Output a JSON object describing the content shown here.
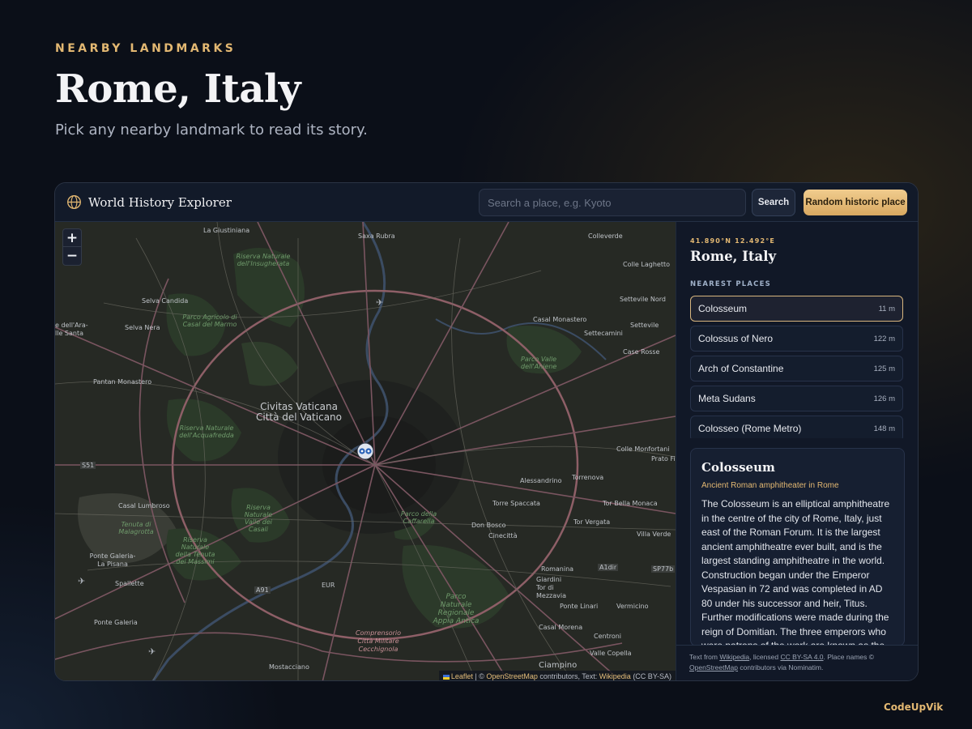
{
  "hero": {
    "eyebrow": "NEARBY LANDMARKS",
    "title": "Rome, Italy",
    "subtitle": "Pick any nearby landmark to read its story."
  },
  "app": {
    "title": "World History Explorer",
    "brand_icon": "globe-icon",
    "search_placeholder": "Search a place, e.g. Kyoto",
    "search_value": "",
    "search_label": "Search",
    "random_label": "Random historic place"
  },
  "map": {
    "zoom_in": "+",
    "zoom_out": "−",
    "marker_icon": "owl-marker-icon",
    "labels": {
      "la_giustiniana": "La Giustiniana",
      "saxa_rubra": "Saxa Rubra",
      "colleverde": "Colleverde",
      "colle_laghetto": "Colle Laghetto",
      "riserva_insugherata": "Riserva Naturale dell'Insugherata",
      "selva_candida": "Selva Candida",
      "parco_marmo": "Parco Agricolo di Casal del Marmo",
      "settevile_nord": "Settevile Nord",
      "casal_monastero": "Casal Monastero",
      "settecamini": "Settecamini",
      "settevile": "Settevile",
      "arat_santa": "e dell'Ara- lle Santa",
      "selva_nera": "Selva Nera",
      "case_rosse": "Case Rosse",
      "valle_aniene": "Parco Valle dell'Aniene",
      "pantan_monastero": "Pantan Monastero",
      "civitas_vaticana": "Civitas Vaticana Città del Vaticano",
      "riserva_acquafredda": "Riserva Naturale dell'Acquafredda",
      "colle_monfortani": "Colle Monfortani",
      "prato_fio": "Prato Fio",
      "s51": "S51",
      "alessandrino": "Alessandrino",
      "torrenova": "Torrenova",
      "casal_lumbroso": "Casal Lumbroso",
      "riserva_valle_galeria": "Riserva Naturale Valle dei Casali",
      "torre_spaccata": "Torre Spaccata",
      "tor_bella_monaca": "Tor Bella Monaca",
      "parco_caffarella": "Parco della Caffarella",
      "tenuta_malagrotta": "Tenuta di Malagrotta",
      "don_bosco": "Don Bosco",
      "tor_vergata": "Tor Vergata",
      "cinecitta": "Cinecittà",
      "villa_verde": "Villa Verde",
      "ponte_galeria_la_pisana": "Ponte Galeria-La Pisana",
      "riserva_tenuta": "Riserva Naturale della Tenuta dei Massimi",
      "a1dir": "A1dir",
      "sp77b": "SP77b",
      "spallette": "Spallette",
      "eur": "EUR",
      "a91": "A91",
      "romanina": "Romanina",
      "giardini_tor": "Giardini Tor di Mezzavia",
      "appia_antica": "Parco Naturale Regionale Appia Antica",
      "ponte_linari": "Ponte Linari",
      "vermicino": "Vermicino",
      "ponte_galeria": "Ponte Galeria",
      "casal_morena": "Casal Morena",
      "centroni": "Centroni",
      "cecchignola": "Comprensorio Città Militare Cecchignola",
      "valle_copella": "Valle Copella",
      "mostacciano": "Mostacciano",
      "ciampino": "Ciampino"
    },
    "attribution": {
      "leaflet": "Leaflet",
      "sep1": " | © ",
      "osm": "OpenStreetMap",
      "mid": " contributors, Text: ",
      "wiki": "Wikipedia",
      "end": " (CC BY-SA)"
    }
  },
  "sidebar": {
    "coords": "41.890°N 12.492°E",
    "place_title": "Rome, Italy",
    "nearest_heading": "NEAREST PLACES",
    "places": [
      {
        "name": "Colosseum",
        "distance": "11 m"
      },
      {
        "name": "Colossus of Nero",
        "distance": "122 m"
      },
      {
        "name": "Arch of Constantine",
        "distance": "125 m"
      },
      {
        "name": "Meta Sudans",
        "distance": "126 m"
      },
      {
        "name": "Colosseo (Rome Metro)",
        "distance": "148 m"
      }
    ],
    "article": {
      "title": "Colosseum",
      "subtitle": "Ancient Roman amphitheater in Rome",
      "body": "The Colosseum is an elliptical amphitheatre in the centre of the city of Rome, Italy, just east of the Roman Forum. It is the largest ancient amphitheatre ever built, and is the largest standing amphitheatre in the world. Construction began under the Emperor Vespasian in 72 and was completed in AD 80 under his successor and heir, Titus. Further modifications were made during the reign of Domitian. The three emperors who were patrons of the work are known as the Flavian dynasty, and the amphitheatre was named"
    },
    "footer": {
      "text_from": "Text from ",
      "wikipedia": "Wikipedia",
      "licensed": ", licensed ",
      "license": "CC BY-SA 4.0",
      "place_names": ". Place names © ",
      "osm": "OpenStreetMap",
      "via": " contributors via Nominatim."
    }
  },
  "watermark": "CodeUpVik",
  "colors": {
    "accent_gold": "#e3b872",
    "background": "#0b0f18",
    "panel": "#111827"
  }
}
